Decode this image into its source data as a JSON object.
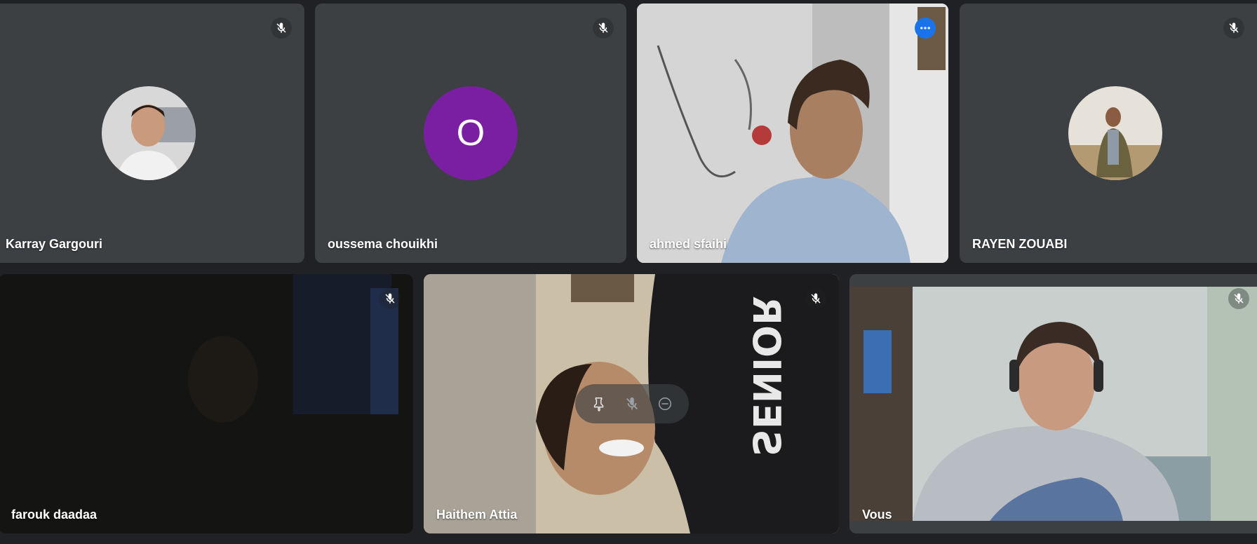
{
  "participants": [
    {
      "name": "Karray Gargouri",
      "mic": "muted"
    },
    {
      "name": "oussema chouikhi",
      "mic": "muted",
      "initial": "O",
      "avatar_color": "#7b1fa2"
    },
    {
      "name": "ahmed sfaihi",
      "speaking": true
    },
    {
      "name": "RAYEN ZOUABI",
      "mic": "muted"
    },
    {
      "name": "farouk daadaa",
      "mic": "muted"
    },
    {
      "name": "Haithem Attia",
      "mic": "muted"
    },
    {
      "name": "Vous",
      "mic": "muted"
    }
  ],
  "icons": {
    "mic_off": "mic-off-icon",
    "more": "more-options-icon",
    "pin": "pin-icon",
    "remove": "remove-icon"
  },
  "colors": {
    "tile_bg": "#3c4043",
    "page_bg": "#202124",
    "active_border": "#8ab4f8",
    "accent": "#1a73e8"
  }
}
